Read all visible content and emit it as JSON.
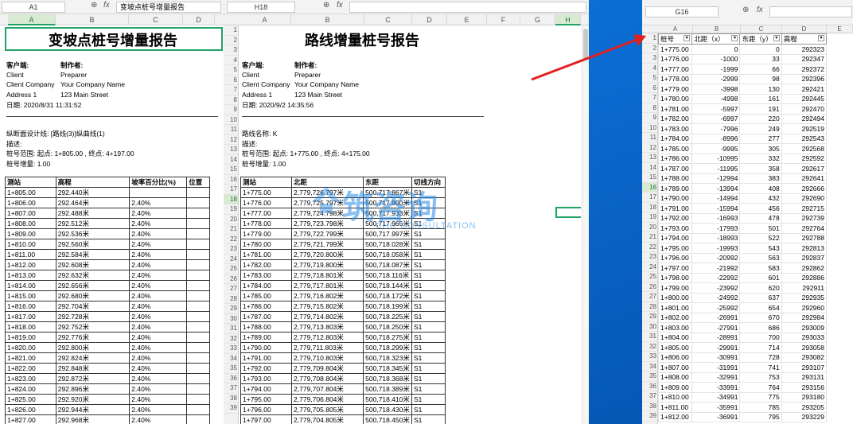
{
  "win1": {
    "namebox": "A1",
    "formula": "变坡点桩号增量报告",
    "columns": [
      "A",
      "B",
      "C",
      "D"
    ],
    "title": "变坡点桩号增量报告",
    "meta": [
      [
        "客户端:",
        "制作者:"
      ],
      [
        "Client",
        "Preparer"
      ],
      [
        "Client Company",
        "Your Company Name"
      ],
      [
        "Address 1",
        "123 Main Street"
      ]
    ],
    "date": "日期: 2020/8/31 11:31:52",
    "design_line": "纵断面设计线: [路线(3)]纵曲线(1)",
    "desc": "描述:",
    "range": "桩号范围: 起点: 1+805.00 , 终点: 4+197.00",
    "increment": "桩号增量: 1.00",
    "table_headers": [
      "测站",
      "高程",
      "坡率百分比(%)",
      "位置"
    ],
    "rows": [
      [
        "1+805.00",
        "292.440米",
        "",
        ""
      ],
      [
        "1+806.00",
        "292.464米",
        "2.40%",
        ""
      ],
      [
        "1+807.00",
        "292.488米",
        "2.40%",
        ""
      ],
      [
        "1+808.00",
        "292.512米",
        "2.40%",
        ""
      ],
      [
        "1+809.00",
        "292.536米",
        "2.40%",
        ""
      ],
      [
        "1+810.00",
        "292.560米",
        "2.40%",
        ""
      ],
      [
        "1+811.00",
        "292.584米",
        "2.40%",
        ""
      ],
      [
        "1+812.00",
        "292.608米",
        "2.40%",
        ""
      ],
      [
        "1+813.00",
        "292.632米",
        "2.40%",
        ""
      ],
      [
        "1+814.00",
        "292.656米",
        "2.40%",
        ""
      ],
      [
        "1+815.00",
        "292.680米",
        "2.40%",
        ""
      ],
      [
        "1+816.00",
        "292.704米",
        "2.40%",
        ""
      ],
      [
        "1+817.00",
        "292.728米",
        "2.40%",
        ""
      ],
      [
        "1+818.00",
        "292.752米",
        "2.40%",
        ""
      ],
      [
        "1+819.00",
        "292.776米",
        "2.40%",
        ""
      ],
      [
        "1+820.00",
        "292.800米",
        "2.40%",
        ""
      ],
      [
        "1+821.00",
        "292.824米",
        "2.40%",
        ""
      ],
      [
        "1+822.00",
        "292.848米",
        "2.40%",
        ""
      ],
      [
        "1+823.00",
        "292.872米",
        "2.40%",
        ""
      ],
      [
        "1+824.00",
        "292.896米",
        "2.40%",
        ""
      ],
      [
        "1+825.00",
        "292.920米",
        "2.40%",
        ""
      ],
      [
        "1+826.00",
        "292.944米",
        "2.40%",
        ""
      ],
      [
        "1+827.00",
        "292.968米",
        "2.40%",
        ""
      ]
    ]
  },
  "win2": {
    "namebox": "H18",
    "formula": "",
    "columns": [
      "A",
      "B",
      "C",
      "D",
      "E",
      "F",
      "G",
      "H"
    ],
    "title": "路线增量桩号报告",
    "meta": [
      [
        "客户端:",
        "制作者:"
      ],
      [
        "Client",
        "Preparer"
      ],
      [
        "Client Company",
        "Your Company Name"
      ],
      [
        "Address 1",
        "123 Main Street"
      ]
    ],
    "date": "日期: 2020/9/2 14:35:56",
    "route_name": "路线名称: K",
    "desc": "描述:",
    "range": "桩号范围: 起点: 1+775.00 , 终点: 4+175.00",
    "increment": "桩号增量: 1.00",
    "row_numbers": [
      "1",
      "2",
      "3",
      "4",
      "5",
      "6",
      "7",
      "8",
      "9",
      "10",
      "11",
      "12",
      "13",
      "14",
      "15",
      "16",
      "17",
      "18",
      "19",
      "20",
      "21",
      "22",
      "23",
      "24",
      "25",
      "26",
      "27",
      "28",
      "29",
      "30",
      "31",
      "32",
      "33",
      "34",
      "35",
      "36",
      "37",
      "38",
      "39"
    ],
    "table_headers": [
      "测站",
      "北距",
      "东距",
      "切线方向"
    ],
    "rows": [
      [
        "1+775.00",
        "2,779,726.797米",
        "500,717.867米",
        "S1"
      ],
      [
        "1+776.00",
        "2,779,725.797米",
        "500,717.900米",
        "S1"
      ],
      [
        "1+777.00",
        "2,779,724.798米",
        "500,717.933米",
        "S1"
      ],
      [
        "1+778.00",
        "2,779,723.798米",
        "500,717.965米",
        "S1"
      ],
      [
        "1+779.00",
        "2,779,722.799米",
        "500,717.997米",
        "S1"
      ],
      [
        "1+780.00",
        "2,779,721.799米",
        "500,718.028米",
        "S1"
      ],
      [
        "1+781.00",
        "2,779,720.800米",
        "500,718.058米",
        "S1"
      ],
      [
        "1+782.00",
        "2,779,719.800米",
        "500,718.087米",
        "S1"
      ],
      [
        "1+783.00",
        "2,779,718.801米",
        "500,718.116米",
        "S1"
      ],
      [
        "1+784.00",
        "2,779,717.801米",
        "500,718.144米",
        "S1"
      ],
      [
        "1+785.00",
        "2,779,716.802米",
        "500,718.172米",
        "S1"
      ],
      [
        "1+786.00",
        "2,779,715.802米",
        "500,718.199米",
        "S1"
      ],
      [
        "1+787.00",
        "2,779,714.802米",
        "500,718.225米",
        "S1"
      ],
      [
        "1+788.00",
        "2,779,713.803米",
        "500,718.250米",
        "S1"
      ],
      [
        "1+789.00",
        "2,779,712.803米",
        "500,718.275米",
        "S1"
      ],
      [
        "1+790.00",
        "2,779,711.803米",
        "500,718.299米",
        "S1"
      ],
      [
        "1+791.00",
        "2,779,710.803米",
        "500,718.323米",
        "S1"
      ],
      [
        "1+792.00",
        "2,779,709.804米",
        "500,718.345米",
        "S1"
      ],
      [
        "1+793.00",
        "2,779,708.804米",
        "500,718.368米",
        "S1"
      ],
      [
        "1+794.00",
        "2,779,707.804米",
        "500,718.389米",
        "S1"
      ],
      [
        "1+795.00",
        "2,779,706.804米",
        "500,718.410米",
        "S1"
      ],
      [
        "1+796.00",
        "2,779,705.805米",
        "500,718.430米",
        "S1"
      ],
      [
        "1+797.00",
        "2,779,704.805米",
        "500,718.450米",
        "S1"
      ]
    ]
  },
  "win3": {
    "namebox": "G16",
    "formula": "",
    "columns": [
      "A",
      "B",
      "C",
      "D",
      "E"
    ],
    "table_headers": [
      "桩号",
      "北距（x）",
      "东距（y）",
      "高程"
    ],
    "row_numbers": [
      "1",
      "2",
      "3",
      "4",
      "5",
      "6",
      "7",
      "8",
      "9",
      "10",
      "11",
      "12",
      "13",
      "14",
      "15",
      "16",
      "17",
      "18",
      "19",
      "20",
      "21",
      "22",
      "23",
      "24",
      "25",
      "26",
      "27",
      "28",
      "29",
      "30",
      "31",
      "32",
      "33",
      "34",
      "35",
      "36",
      "37",
      "38",
      "39"
    ],
    "rows": [
      [
        "1+775.00",
        "0",
        "0",
        "292323"
      ],
      [
        "1+776.00",
        "-1000",
        "33",
        "292347"
      ],
      [
        "1+777.00",
        "-1999",
        "66",
        "292372"
      ],
      [
        "1+778.00",
        "-2999",
        "98",
        "292396"
      ],
      [
        "1+779.00",
        "-3998",
        "130",
        "292421"
      ],
      [
        "1+780.00",
        "-4998",
        "161",
        "292445"
      ],
      [
        "1+781.00",
        "-5997",
        "191",
        "292470"
      ],
      [
        "1+782.00",
        "-6997",
        "220",
        "292494"
      ],
      [
        "1+783.00",
        "-7996",
        "249",
        "292519"
      ],
      [
        "1+784.00",
        "-8996",
        "277",
        "292543"
      ],
      [
        "1+785.00",
        "-9995",
        "305",
        "292568"
      ],
      [
        "1+786.00",
        "-10995",
        "332",
        "292592"
      ],
      [
        "1+787.00",
        "-11995",
        "358",
        "292617"
      ],
      [
        "1+788.00",
        "-12994",
        "383",
        "292641"
      ],
      [
        "1+789.00",
        "-13994",
        "408",
        "292666"
      ],
      [
        "1+790.00",
        "-14994",
        "432",
        "292690"
      ],
      [
        "1+791.00",
        "-15994",
        "456",
        "292715"
      ],
      [
        "1+792.00",
        "-16993",
        "478",
        "292739"
      ],
      [
        "1+793.00",
        "-17993",
        "501",
        "292764"
      ],
      [
        "1+794.00",
        "-18993",
        "522",
        "292788"
      ],
      [
        "1+795.00",
        "-19993",
        "543",
        "292813"
      ],
      [
        "1+796.00",
        "-20992",
        "563",
        "292837"
      ],
      [
        "1+797.00",
        "-21992",
        "583",
        "292862"
      ],
      [
        "1+798.00",
        "-22992",
        "601",
        "292886"
      ],
      [
        "1+799.00",
        "-23992",
        "620",
        "292911"
      ],
      [
        "1+800.00",
        "-24992",
        "637",
        "292935"
      ],
      [
        "1+801.00",
        "-25992",
        "654",
        "292960"
      ],
      [
        "1+802.00",
        "-26991",
        "670",
        "292984"
      ],
      [
        "1+803.00",
        "-27991",
        "686",
        "293009"
      ],
      [
        "1+804.00",
        "-28991",
        "700",
        "293033"
      ],
      [
        "1+805.00",
        "-29991",
        "714",
        "293058"
      ],
      [
        "1+806.00",
        "-30991",
        "728",
        "293082"
      ],
      [
        "1+807.00",
        "-31991",
        "741",
        "293107"
      ],
      [
        "1+808.00",
        "-32991",
        "753",
        "293131"
      ],
      [
        "1+809.00",
        "-33991",
        "764",
        "293156"
      ],
      [
        "1+810.00",
        "-34991",
        "775",
        "293180"
      ],
      [
        "1+811.00",
        "-35991",
        "785",
        "293205"
      ],
      [
        "1+812.00",
        "-36991",
        "795",
        "293229"
      ]
    ]
  },
  "watermark": {
    "main": "筑咨询",
    "sub": "CHU CONSULTATION"
  },
  "colors": {
    "excel_green": "#21a366",
    "arrow_red": "#e02020",
    "desktop_blue": "#0a64c8"
  },
  "icons": {
    "zoom": "zoom-icon",
    "fx": "fx-icon"
  }
}
